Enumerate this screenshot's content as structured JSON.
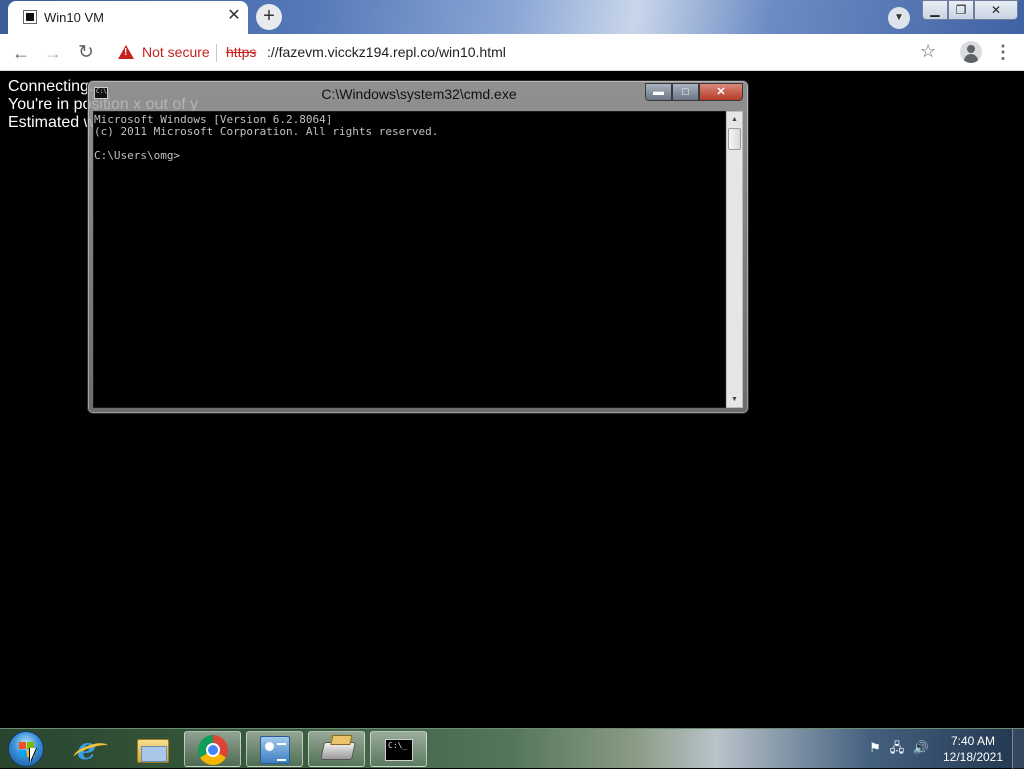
{
  "browser": {
    "tab": {
      "title": "Win10 VM",
      "close_glyph": "✕"
    },
    "new_tab_glyph": "+",
    "tab_search_glyph": "▼",
    "window_controls": {
      "minimize": "▁",
      "maximize": "❐",
      "close": "✕"
    },
    "nav": {
      "back": "←",
      "forward": "→",
      "reload": "↻",
      "star": "☆",
      "menu": "⋮"
    },
    "security_label": "Not secure",
    "url_scheme": "https",
    "url_rest": "://fazevm.vicckz194.repl.co/win10.html"
  },
  "page": {
    "status_lines": [
      "Connecting...",
      "You're in position x out of y",
      "Estimated w"
    ]
  },
  "cmd_window": {
    "title": "C:\\Windows\\system32\\cmd.exe",
    "icon_text": "C:\\",
    "controls": {
      "minimize": "▬",
      "maximize": "□",
      "close": "✕"
    },
    "console_text": "Microsoft Windows [Version 6.2.8064]\n(c) 2011 Microsoft Corporation. All rights reserved.\n\nC:\\Users\\omg>",
    "scroll_up": "▲",
    "scroll_down": "▼"
  },
  "taskbar": {
    "pinned": [
      {
        "name": "internet-explorer",
        "icon": "ie-icon"
      },
      {
        "name": "windows-explorer",
        "icon": "folder-icon"
      },
      {
        "name": "google-chrome",
        "icon": "chrome-icon"
      },
      {
        "name": "control-panel",
        "icon": "control-panel-icon"
      },
      {
        "name": "removable-drive",
        "icon": "drive-icon"
      },
      {
        "name": "command-prompt",
        "icon": "cmd-icon"
      }
    ],
    "cmd_icon_text": "C:\\_",
    "tray": {
      "flag": "⚑",
      "network": "🖧",
      "volume": "🔊"
    },
    "clock": {
      "time": "7:40 AM",
      "date": "12/18/2021"
    }
  }
}
